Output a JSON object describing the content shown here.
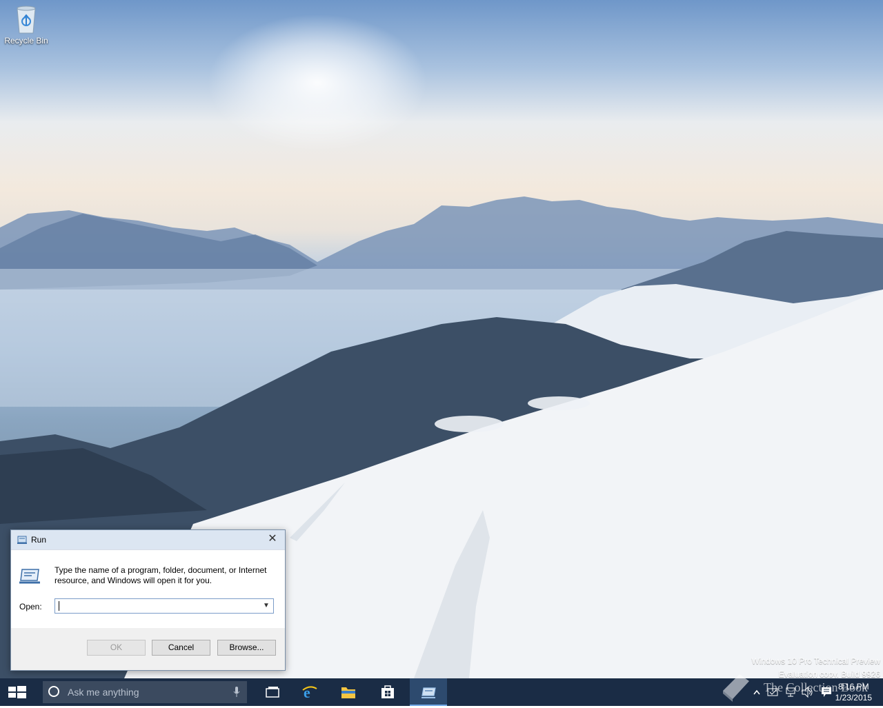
{
  "desktop": {
    "icons": [
      {
        "label": "Recycle Bin",
        "icon": "recycle-bin-icon"
      }
    ],
    "watermark": {
      "line1": "Windows 10 Pro Technical Preview",
      "line2": "Evaluation copy. Build 9926"
    }
  },
  "run_dialog": {
    "title": "Run",
    "close_label": "✕",
    "description": "Type the name of a program, folder, document, or Internet resource, and Windows will open it for you.",
    "open_label": "Open:",
    "open_value": "",
    "buttons": {
      "ok": "OK",
      "cancel": "Cancel",
      "browse": "Browse..."
    }
  },
  "taskbar": {
    "search_placeholder": "Ask me anything",
    "apps": [
      {
        "name": "task-view",
        "icon": "task-view-icon"
      },
      {
        "name": "internet-explorer",
        "icon": "internet-explorer-icon"
      },
      {
        "name": "file-explorer",
        "icon": "folder-icon"
      },
      {
        "name": "store",
        "icon": "store-icon"
      },
      {
        "name": "run",
        "icon": "run-icon",
        "active": true
      }
    ],
    "tray": {
      "time": "8:16 PM",
      "date": "1/23/2015",
      "icons": [
        "chevron-up-icon",
        "action-center-flag-icon",
        "network-icon",
        "volume-icon",
        "notification-icon"
      ]
    },
    "overlay_watermark": "The Collection Book"
  },
  "colors": {
    "taskbar": "#1a2c45",
    "accent": "#2d4a6e",
    "dialog_title": "#dce6f2"
  }
}
